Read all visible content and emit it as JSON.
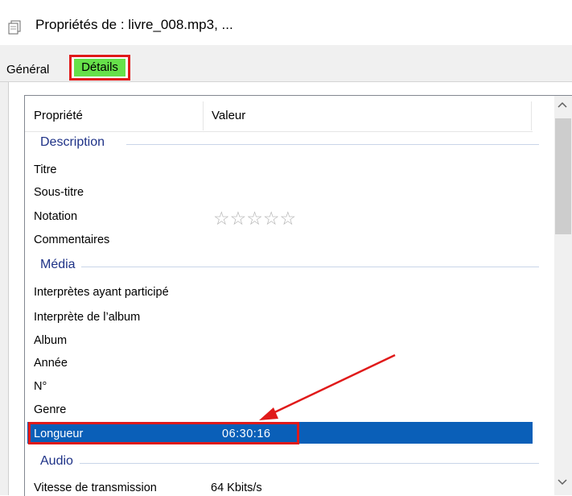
{
  "window": {
    "title": "Propriétés de : livre_008.mp3, ..."
  },
  "tabs": [
    {
      "label": "Général"
    },
    {
      "label": "Détails"
    }
  ],
  "columns": {
    "property": "Propriété",
    "value": "Valeur"
  },
  "groups": {
    "description": "Description",
    "media": "Média",
    "audio": "Audio"
  },
  "rows": {
    "titre": {
      "label": "Titre",
      "value": ""
    },
    "sous_titre": {
      "label": "Sous-titre",
      "value": ""
    },
    "notation": {
      "label": "Notation",
      "stars": "☆☆☆☆☆",
      "rating": 0,
      "max_rating": 5
    },
    "commentaires": {
      "label": "Commentaires",
      "value": ""
    },
    "interpretes": {
      "label": "Interprètes ayant participé",
      "value": ""
    },
    "interprete_album": {
      "label": "Interprète de l’album",
      "value": ""
    },
    "album": {
      "label": "Album",
      "value": ""
    },
    "annee": {
      "label": "Année",
      "value": ""
    },
    "numero": {
      "label": "N°",
      "value": ""
    },
    "genre": {
      "label": "Genre",
      "value": ""
    },
    "longueur": {
      "label": "Longueur",
      "value": "06:30:16"
    },
    "vitesse": {
      "label": "Vitesse de transmission",
      "value": "64 Kbits/s"
    }
  },
  "colors": {
    "selection": "#0a5fb8",
    "highlight_border": "#e01a1a",
    "tab_highlight": "#66e04a",
    "group_text": "#1e3287"
  },
  "icons": {
    "window": "properties-window-icon",
    "scroll_up": "chevron-up-icon",
    "scroll_down": "chevron-down-icon",
    "annotation": "red-arrow-annotation"
  }
}
